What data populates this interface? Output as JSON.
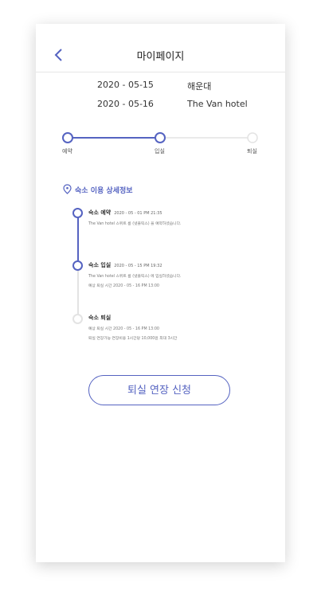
{
  "header": {
    "title": "마이페이지"
  },
  "booking": {
    "checkin_date": "2020 - 05-15",
    "location": "해운대",
    "checkout_date": "2020 - 05-16",
    "hotel": "The Van hotel"
  },
  "progress": {
    "steps": [
      "예약",
      "입실",
      "퇴실"
    ],
    "current_step_index": 1
  },
  "details": {
    "section_title": "숙소 이용 상세정보",
    "events": [
      {
        "title": "숙소 예약",
        "timestamp": "2020 - 05 - 01 PM 21:35",
        "lines": [
          "The Van hotel 스위트 룸 (넷플릭스) 을 예약하셨습니다."
        ]
      },
      {
        "title": "숙소 입실",
        "timestamp": "2020 - 05 - 15 PM 19:32",
        "lines": [
          "The Van hotel 스위트 룸 (넷플릭스) 에 입실하셨습니다.",
          "예상 퇴실 시간 2020 - 05 - 16 PM 13:00"
        ]
      },
      {
        "title": "숙소 퇴실",
        "timestamp": "",
        "lines": [
          "예상 퇴실 시간 2020 - 05 - 16 PM 13:00",
          "퇴실 연장가능 연장비용 1시간당 10,000원 최대 3시간"
        ]
      }
    ]
  },
  "actions": {
    "extend_label": "퇴실 연장 신청"
  },
  "colors": {
    "accent": "#5563c1",
    "inactive": "#e3e3e3"
  }
}
